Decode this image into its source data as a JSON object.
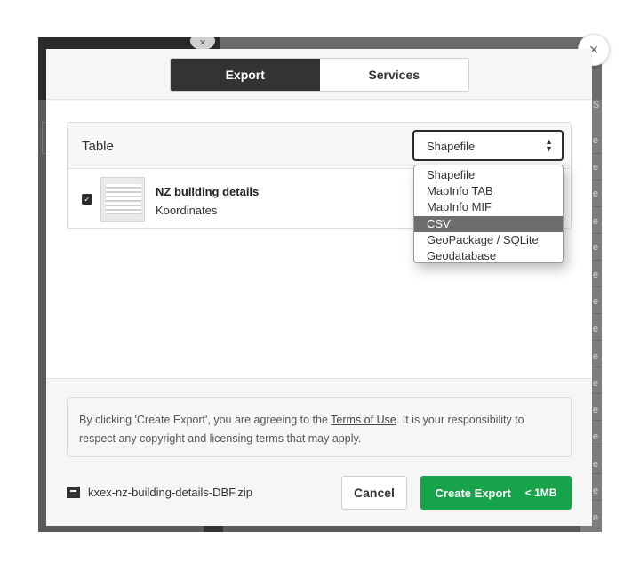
{
  "modal": {
    "close_label": "×",
    "tabs": [
      {
        "label": "Export",
        "active": true
      },
      {
        "label": "Services",
        "active": false
      }
    ]
  },
  "table": {
    "title": "Table",
    "format_select": {
      "selected": "Shapefile",
      "options": [
        "Shapefile",
        "MapInfo TAB",
        "MapInfo MIF",
        "CSV",
        "GeoPackage / SQLite",
        "Geodatabase"
      ],
      "highlighted": "CSV"
    },
    "dataset": {
      "checked": true,
      "title": "NZ building details",
      "subtitle": "Koordinates"
    }
  },
  "footer": {
    "terms_prefix": "By clicking 'Create Export', you are agreeing to the ",
    "terms_link": "Terms of Use",
    "terms_suffix": ". It is your responsibility to respect any copyright and licensing terms that may apply.",
    "filename": "kxex-nz-building-details-DBF.zip",
    "cancel_label": "Cancel",
    "create_label": "Create Export",
    "create_size": "< 1MB"
  },
  "background": {
    "close_label": "×",
    "row_letter": "e",
    "header_letter": "S"
  },
  "colors": {
    "primary": "#16a34a",
    "tab_active": "#333333",
    "select_border": "#2b2b2b",
    "option_highlight": "#6e6e6e"
  },
  "icons": [
    "close-icon",
    "select-arrow-icon",
    "checkbox-checked-icon",
    "archive-icon"
  ]
}
